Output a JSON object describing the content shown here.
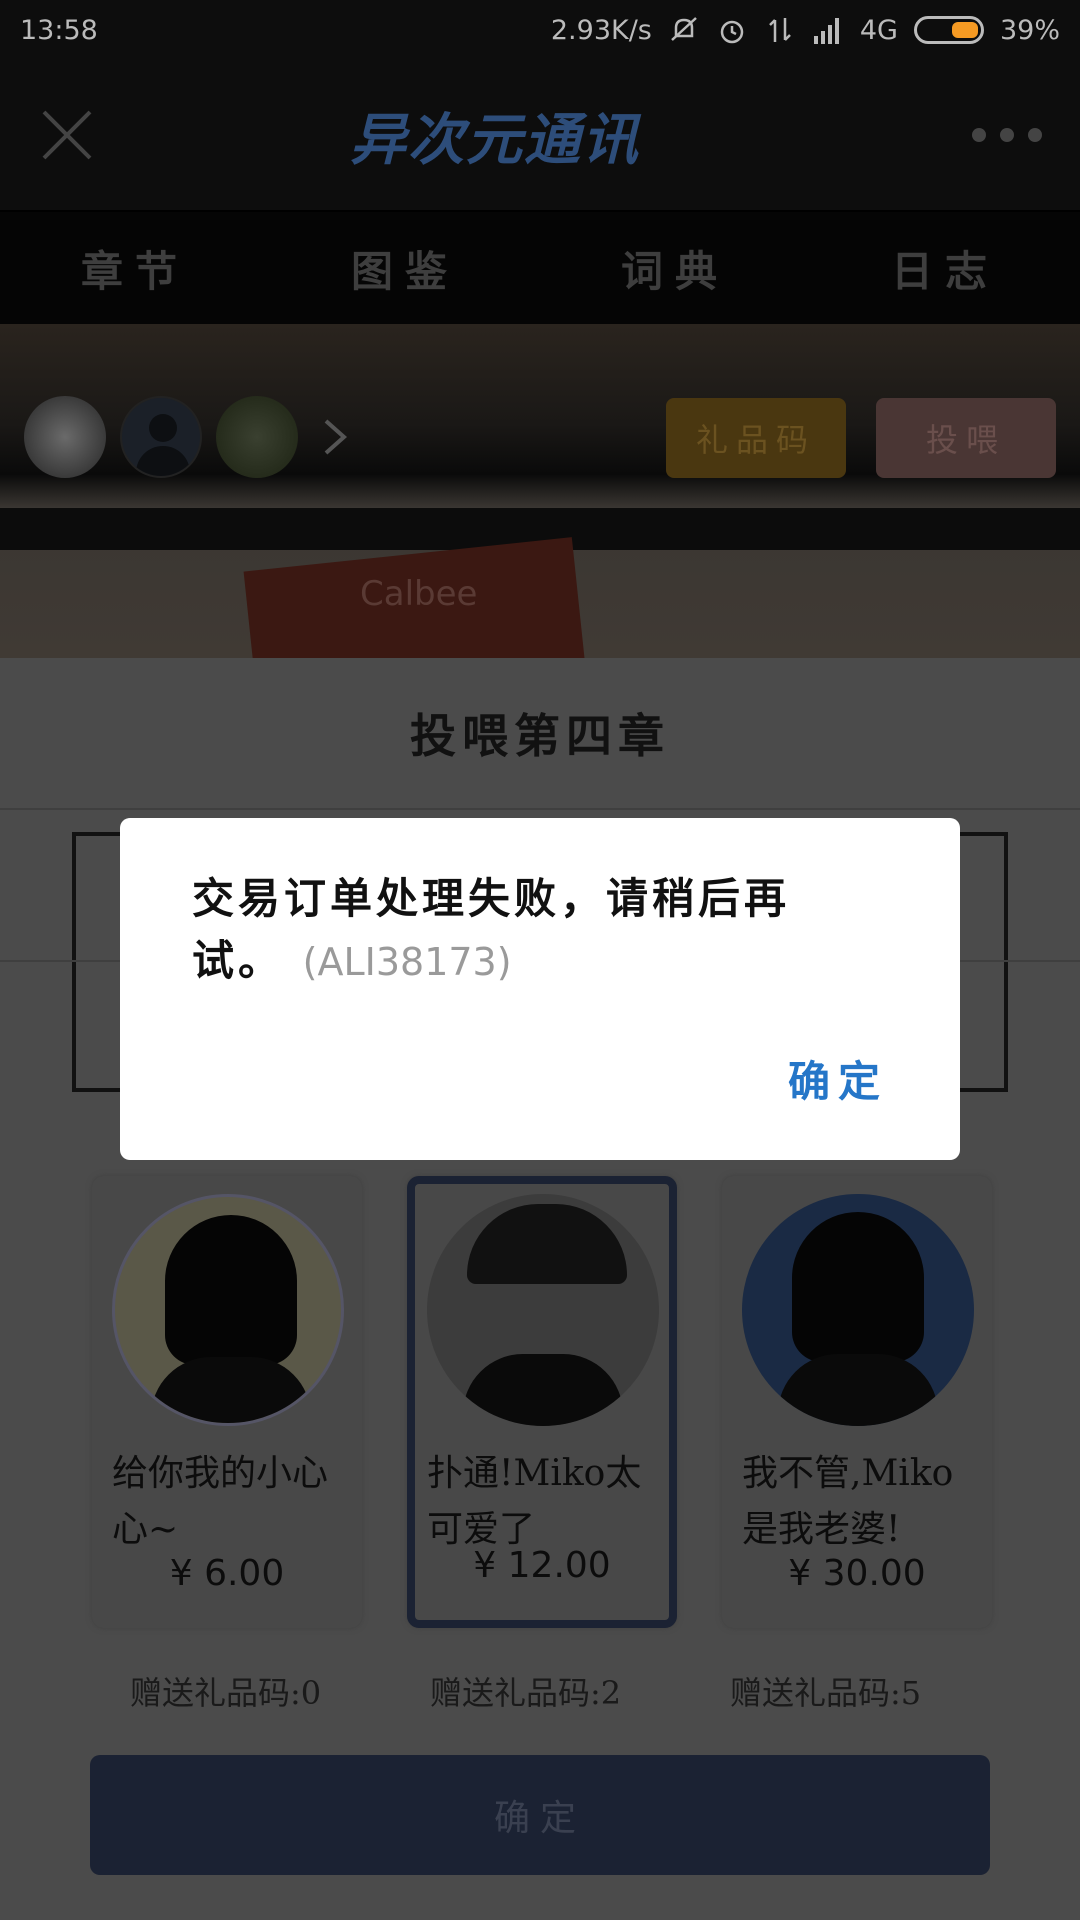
{
  "status_bar": {
    "time": "13:58",
    "net_speed": "2.93K/s",
    "network": "4G",
    "battery": "39%",
    "battery_color": "#f59a23"
  },
  "header": {
    "logo_text": "异次元通讯",
    "icons": [
      "close-icon",
      "more-icon"
    ]
  },
  "tabs": [
    "章节",
    "图鉴",
    "词典",
    "日志"
  ],
  "banner": {
    "gift_code_button": "礼品码",
    "feed_button": "投喂",
    "card_text": "Calbee"
  },
  "sheet": {
    "title": "投喂第四章",
    "options": [
      {
        "desc": "给你我的小心心~",
        "price": "¥ 6.00",
        "bonus": "赠送礼品码:0"
      },
      {
        "desc": "扑通!Miko太可爱了",
        "price": "¥ 12.00",
        "bonus": "赠送礼品码:2",
        "selected": true
      },
      {
        "desc": "我不管,Miko是我老婆!",
        "price": "¥ 30.00",
        "bonus": "赠送礼品码:5"
      }
    ],
    "confirm_label": "确定"
  },
  "dialog": {
    "message": "交易订单处理失败，请稍后再试。",
    "code": "(ALI38173)",
    "ok_label": "确定",
    "ok_color": "#2576c8"
  }
}
